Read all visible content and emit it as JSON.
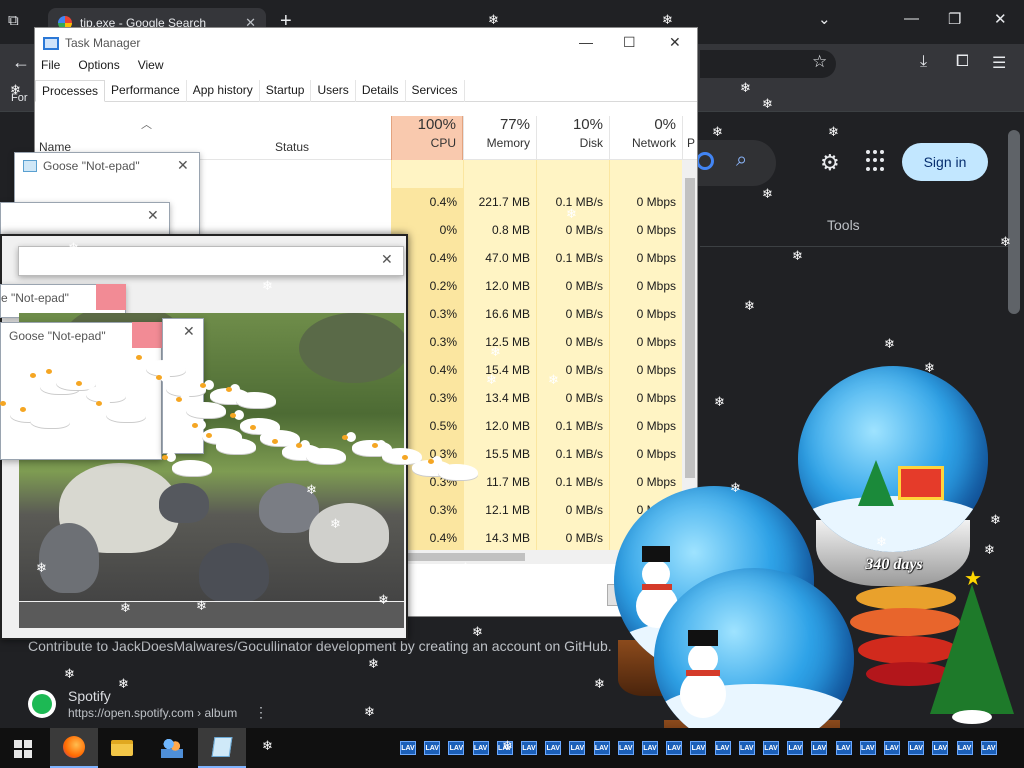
{
  "browser": {
    "tab_title": "tip.exe - Google Search",
    "tab_close": "✕",
    "new_tab": "+",
    "bookmark_text": "For"
  },
  "google": {
    "sign_in": "Sign in",
    "tools": "Tools",
    "snippet": "Contribute to JackDoesMalwares/Gocullinator development by creating an account on GitHub.",
    "result_name": "Spotify",
    "result_url": "https://open.spotify.com › album"
  },
  "task_manager": {
    "title": "Task Manager",
    "menu": [
      "File",
      "Options",
      "View"
    ],
    "tabs": [
      "Processes",
      "Performance",
      "App history",
      "Startup",
      "Users",
      "Details",
      "Services"
    ],
    "active_tab": "Processes",
    "columns": {
      "name": "Name",
      "status": "Status",
      "cpu_pct": "100%",
      "cpu_label": "CPU",
      "mem_pct": "77%",
      "mem_label": "Memory",
      "disk_pct": "10%",
      "disk_label": "Disk",
      "net_pct": "0%",
      "net_label": "Network",
      "power_label": "P"
    },
    "rows": [
      {
        "cpu": "",
        "memory": "",
        "disk": "",
        "network": ""
      },
      {
        "cpu": "0.4%",
        "memory": "221.7 MB",
        "disk": "0.1 MB/s",
        "network": "0 Mbps"
      },
      {
        "cpu": "0%",
        "memory": "0.8 MB",
        "disk": "0 MB/s",
        "network": "0 Mbps"
      },
      {
        "cpu": "0.4%",
        "memory": "47.0 MB",
        "disk": "0.1 MB/s",
        "network": "0 Mbps"
      },
      {
        "cpu": "0.2%",
        "memory": "12.0 MB",
        "disk": "0 MB/s",
        "network": "0 Mbps"
      },
      {
        "cpu": "0.3%",
        "memory": "16.6 MB",
        "disk": "0 MB/s",
        "network": "0 Mbps"
      },
      {
        "cpu": "0.3%",
        "memory": "12.5 MB",
        "disk": "0 MB/s",
        "network": "0 Mbps"
      },
      {
        "cpu": "0.4%",
        "memory": "15.4 MB",
        "disk": "0 MB/s",
        "network": "0 Mbps"
      },
      {
        "cpu": "0.3%",
        "memory": "13.4 MB",
        "disk": "0 MB/s",
        "network": "0 Mbps"
      },
      {
        "cpu": "0.5%",
        "memory": "12.0 MB",
        "disk": "0.1 MB/s",
        "network": "0 Mbps"
      },
      {
        "cpu": "0.3%",
        "memory": "15.5 MB",
        "disk": "0.1 MB/s",
        "network": "0 Mbps"
      },
      {
        "cpu": "0.3%",
        "memory": "11.7 MB",
        "disk": "0.1 MB/s",
        "network": "0 Mbps"
      },
      {
        "cpu": "0.3%",
        "memory": "12.1 MB",
        "disk": "0 MB/s",
        "network": "0 Mbps"
      },
      {
        "cpu": "0.4%",
        "memory": "14.3 MB",
        "disk": "0 MB/s",
        "network": "0 Mbps"
      }
    ]
  },
  "goose_windows": {
    "title_full": "Goose \"Not-epad\"",
    "title_cut": "e \"Not-epad\"",
    "close": "✕"
  },
  "snow_globes": {
    "days_label": "340 days"
  },
  "icons": {
    "tab_list": "tab-list-icon",
    "back": "back-arrow-icon",
    "star": "bookmark-star-icon",
    "download": "download-icon",
    "extensions": "extensions-icon",
    "menu": "hamburger-menu-icon",
    "settings": "gear-icon",
    "apps": "apps-grid-icon",
    "search": "search-icon",
    "lens": "lens-icon",
    "start": "windows-start-icon"
  },
  "taskbar": {
    "tray_badge": "LAV"
  },
  "colors": {
    "google_bg": "#202124",
    "signin_bg": "#c2e7ff",
    "cpu_header": "#f9c9ae",
    "cell_yellow": "#fff4c4",
    "goose_close_red": "#f28b95"
  }
}
